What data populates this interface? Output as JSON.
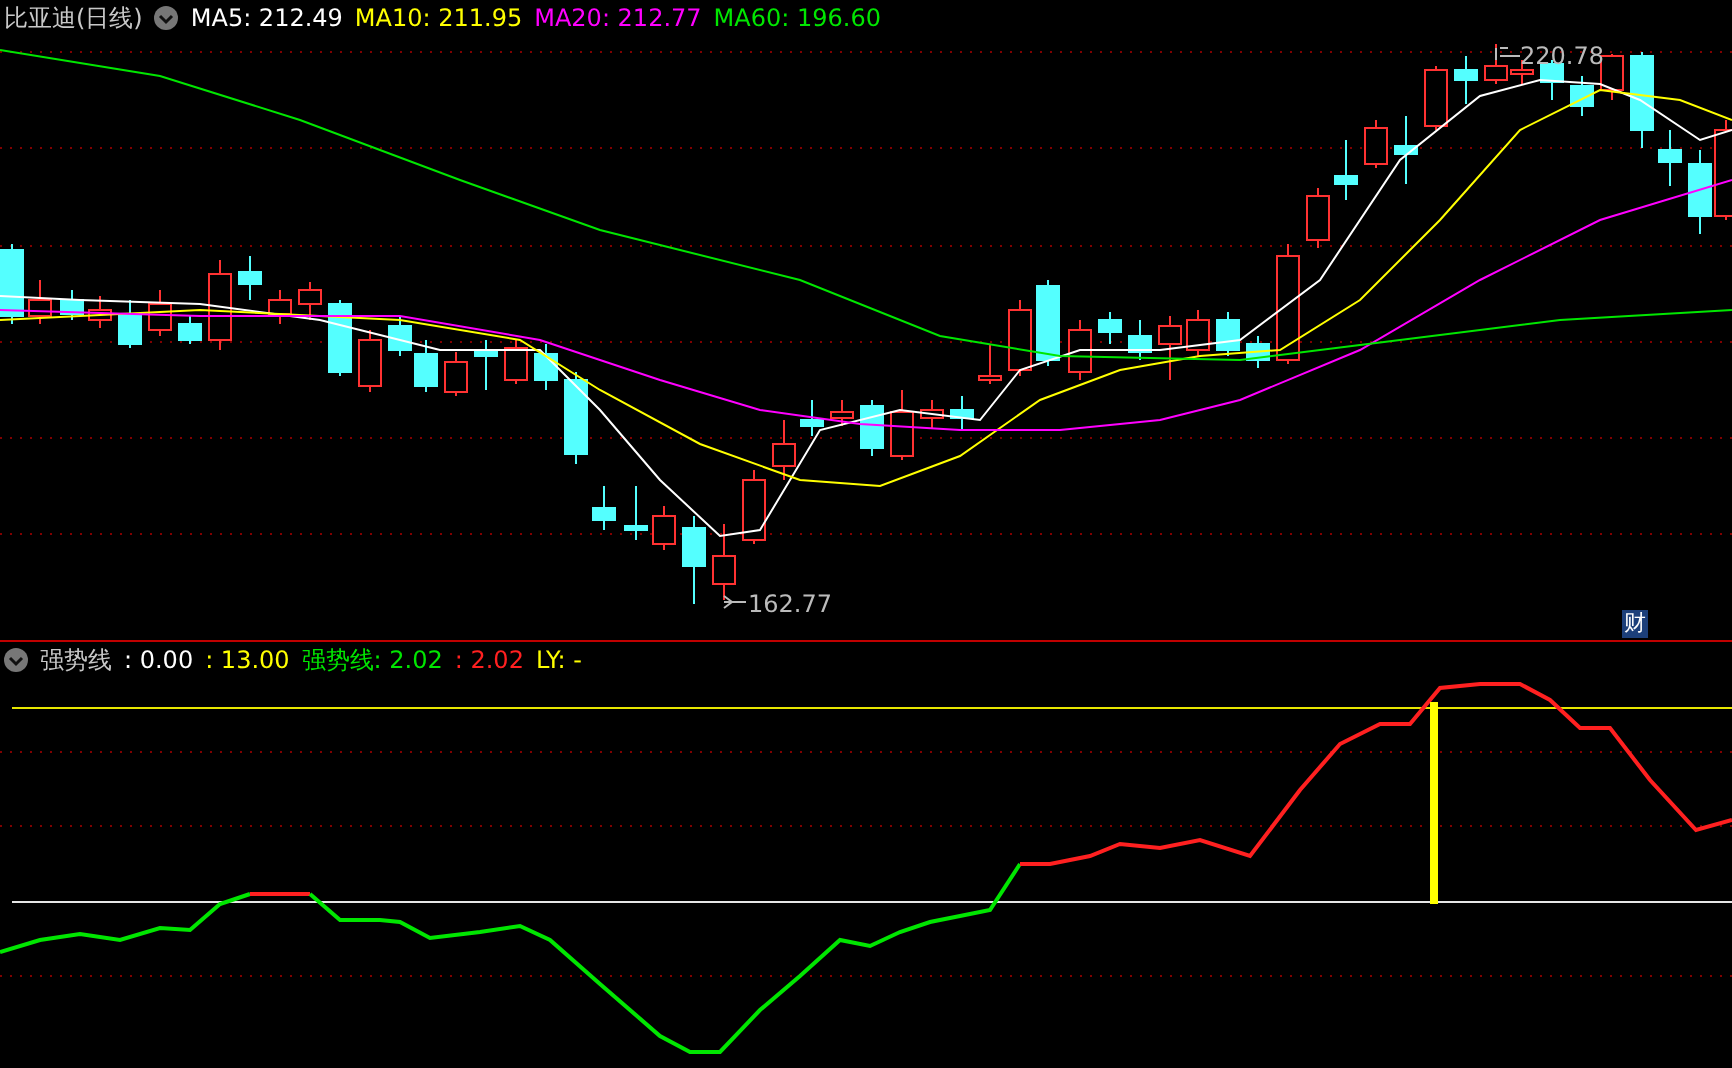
{
  "main_chart": {
    "title": "比亚迪(日线)",
    "indicators": [
      {
        "label": "MA5: 212.49",
        "color": "#ffffff"
      },
      {
        "label": "MA10: 211.95",
        "color": "#ffff00"
      },
      {
        "label": "MA20: 212.77",
        "color": "#ff00ff"
      },
      {
        "label": "MA60: 196.60",
        "color": "#00e600"
      }
    ],
    "high_label": "220.78",
    "low_label": "162.77",
    "badge": "财"
  },
  "sub_chart": {
    "title": "强势线",
    "values": [
      {
        "label": ": 0.00",
        "color": "#ffffff"
      },
      {
        "label": ": 13.00",
        "color": "#ffff00"
      },
      {
        "label": "强势线: 2.02",
        "color": "#00e600"
      },
      {
        "label": ": 2.02",
        "color": "#ff2020"
      },
      {
        "label": "LY: -",
        "color": "#ffff00"
      }
    ]
  }
}
